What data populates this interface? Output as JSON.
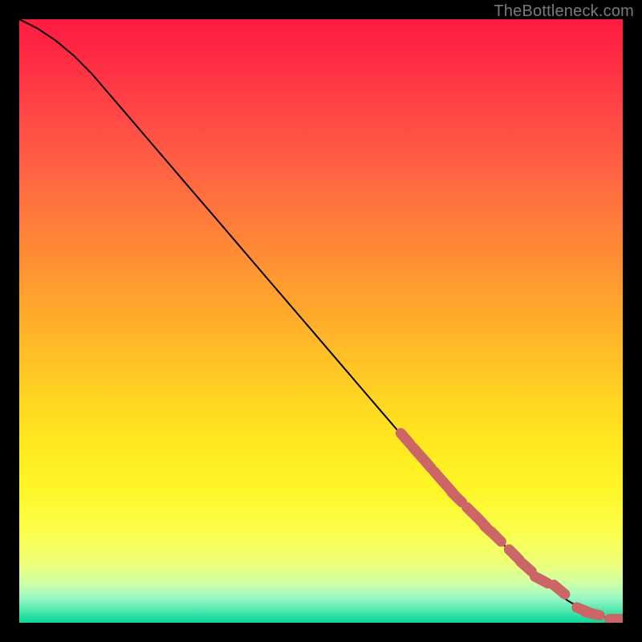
{
  "watermark": "TheBottleneck.com",
  "chart_data": {
    "type": "line",
    "title": "",
    "xlabel": "",
    "ylabel": "",
    "xlim": [
      0,
      100
    ],
    "ylim": [
      0,
      100
    ],
    "grid": false,
    "series": [
      {
        "name": "curve",
        "kind": "line",
        "color": "#000000",
        "x": [
          0,
          3,
          6,
          9,
          12,
          15,
          18,
          21,
          24,
          27,
          30,
          33,
          36,
          39,
          42,
          45,
          48,
          51,
          54,
          57,
          60,
          63,
          66,
          69,
          72,
          75,
          78,
          81,
          84,
          87,
          89,
          91,
          93,
          95,
          97,
          99,
          100
        ],
        "y": [
          100,
          98.5,
          96.5,
          94,
          91,
          87.5,
          84,
          80.5,
          77,
          73.5,
          70,
          66.5,
          63,
          59.5,
          56,
          52.5,
          49,
          45.5,
          42,
          38.5,
          35,
          31.5,
          28,
          24.7,
          21.5,
          18.3,
          15.2,
          12.2,
          9.3,
          6.6,
          5.0,
          3.6,
          2.4,
          1.5,
          0.9,
          0.6,
          0.6
        ]
      },
      {
        "name": "markers",
        "kind": "scatter",
        "color": "#cc6666",
        "x": [
          64.0,
          66.0,
          67.5,
          69.5,
          71.0,
          72.5,
          75.0,
          76.5,
          78.0,
          79.0,
          82.0,
          84.0,
          86.5,
          89.5,
          93.5,
          95.0,
          99.0,
          100.0
        ],
        "y": [
          30.5,
          28.2,
          26.5,
          24.2,
          22.5,
          20.8,
          18.3,
          16.8,
          15.2,
          14.3,
          11.3,
          9.3,
          7.1,
          5.5,
          2.1,
          1.5,
          0.6,
          0.6
        ]
      }
    ],
    "gradient_stops": [
      {
        "offset": 0.0,
        "color": "#ff1a42"
      },
      {
        "offset": 0.06,
        "color": "#ff2a44"
      },
      {
        "offset": 0.14,
        "color": "#ff4246"
      },
      {
        "offset": 0.22,
        "color": "#ff5a44"
      },
      {
        "offset": 0.3,
        "color": "#ff723e"
      },
      {
        "offset": 0.38,
        "color": "#ff8a36"
      },
      {
        "offset": 0.46,
        "color": "#ffa22e"
      },
      {
        "offset": 0.54,
        "color": "#ffba28"
      },
      {
        "offset": 0.62,
        "color": "#ffd222"
      },
      {
        "offset": 0.7,
        "color": "#ffe81e"
      },
      {
        "offset": 0.78,
        "color": "#fff628"
      },
      {
        "offset": 0.85,
        "color": "#fbff4c"
      },
      {
        "offset": 0.9,
        "color": "#eeff75"
      },
      {
        "offset": 0.935,
        "color": "#cfffa9"
      },
      {
        "offset": 0.96,
        "color": "#97f7c3"
      },
      {
        "offset": 0.978,
        "color": "#55e9b0"
      },
      {
        "offset": 0.992,
        "color": "#20dba0"
      },
      {
        "offset": 1.0,
        "color": "#10d69a"
      }
    ]
  }
}
